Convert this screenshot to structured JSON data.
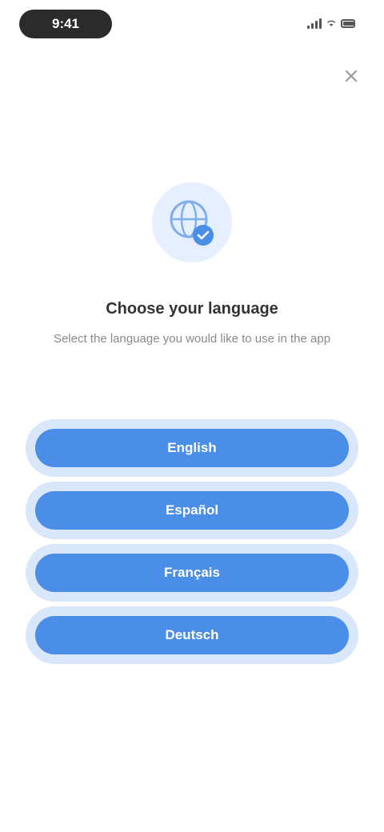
{
  "status_bar": {
    "time": "9:41"
  },
  "header": {
    "close_label": "×"
  },
  "hero": {
    "icon": "globe-icon"
  },
  "title": "Choose your language",
  "subtitle": "Select the language you would like to use in the app",
  "options": [
    {
      "label": "English"
    },
    {
      "label": "Español"
    },
    {
      "label": "Français"
    },
    {
      "label": "Deutsch"
    }
  ],
  "colors": {
    "accent": "#4a8ee8",
    "accent_light": "#d9e7fb",
    "icon_bg": "#e6efff"
  }
}
